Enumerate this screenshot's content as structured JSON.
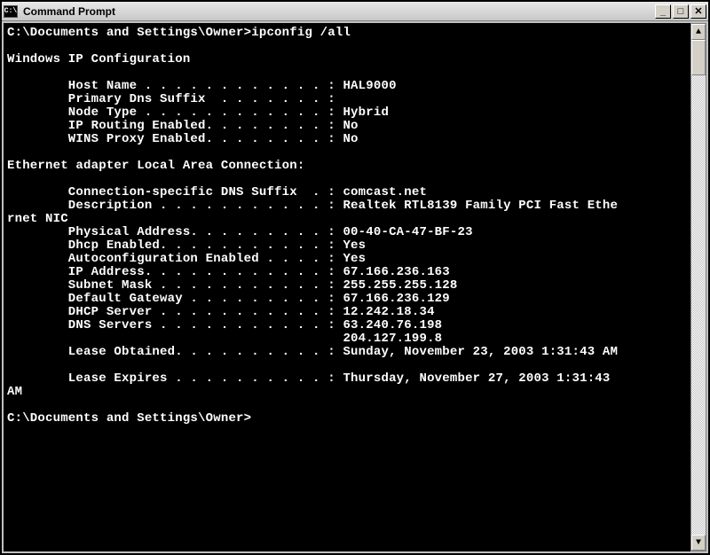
{
  "window": {
    "title": "Command Prompt",
    "sys_icon_label": "C:\\"
  },
  "session": {
    "prompt1_line": "C:\\Documents and Settings\\Owner>ipconfig /all",
    "prompt2_line": "C:\\Documents and Settings\\Owner>",
    "header": "Windows IP Configuration",
    "fields": {
      "host_name_line": "        Host Name . . . . . . . . . . . . : HAL9000",
      "primary_dns_suffix_line": "        Primary Dns Suffix  . . . . . . . :",
      "node_type_line": "        Node Type . . . . . . . . . . . . : Hybrid",
      "ip_routing_line": "        IP Routing Enabled. . . . . . . . : No",
      "wins_proxy_line": "        WINS Proxy Enabled. . . . . . . . : No"
    },
    "adapter_header": "Ethernet adapter Local Area Connection:",
    "adapter": {
      "conn_suffix_line": "        Connection-specific DNS Suffix  . : comcast.net",
      "description_line1": "        Description . . . . . . . . . . . : Realtek RTL8139 Family PCI Fast Ethe",
      "description_line2": "rnet NIC",
      "physical_line": "        Physical Address. . . . . . . . . : 00-40-CA-47-BF-23",
      "dhcp_enabled_line": "        Dhcp Enabled. . . . . . . . . . . : Yes",
      "autoconf_line": "        Autoconfiguration Enabled . . . . : Yes",
      "ip_address_line": "        IP Address. . . . . . . . . . . . : 67.166.236.163",
      "subnet_line": "        Subnet Mask . . . . . . . . . . . : 255.255.255.128",
      "gateway_line": "        Default Gateway . . . . . . . . . : 67.166.236.129",
      "dhcp_server_line": "        DHCP Server . . . . . . . . . . . : 12.242.18.34",
      "dns1_line": "        DNS Servers . . . . . . . . . . . : 63.240.76.198",
      "dns2_line": "                                            204.127.199.8",
      "lease_obtained_line": "        Lease Obtained. . . . . . . . . . : Sunday, November 23, 2003 1:31:43 AM",
      "lease_expires_1": "        Lease Expires . . . . . . . . . . : Thursday, November 27, 2003 1:31:43 ",
      "lease_expires_2": "AM"
    }
  },
  "controls": {
    "minimize": "_",
    "maximize": "□",
    "close": "✕",
    "scroll_up": "▲",
    "scroll_down": "▼"
  }
}
